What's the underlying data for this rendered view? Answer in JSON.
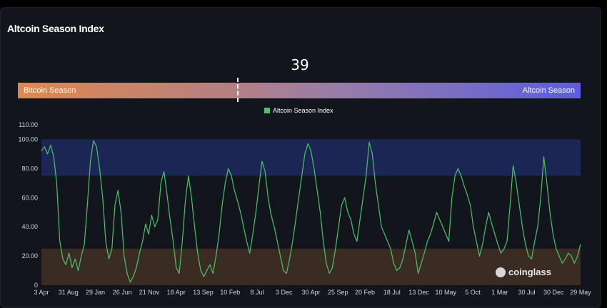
{
  "header": {
    "title": "Altcoin Season Index"
  },
  "gauge": {
    "value": "39",
    "value_num": 39,
    "left_label": "Bitcoin Season",
    "right_label": "Altcoin Season",
    "colors": {
      "start": "#e0884a",
      "end": "#5b5de0"
    }
  },
  "watermark": "coinglass",
  "chart_data": {
    "type": "line",
    "title": "",
    "legend": [
      "Altcoin Season Index"
    ],
    "legend_position": "top-center",
    "line_color": "#4cc26a",
    "ylim": [
      0,
      110
    ],
    "yticks": [
      "0",
      "20.00",
      "40.00",
      "60.00",
      "80.00",
      "100.00",
      "110.00"
    ],
    "ytick_values": [
      0,
      20,
      40,
      60,
      80,
      100,
      110
    ],
    "xticks": [
      "3 Apr",
      "31 Aug",
      "29 Jan",
      "26 Jun",
      "21 Nov",
      "18 Apr",
      "13 Sep",
      "10 Feb",
      "8 Jul",
      "3 Dec",
      "30 Apr",
      "25 Sep",
      "20 Feb",
      "18 Jul",
      "13 Dec",
      "10 May",
      "5 Oct",
      "1 Mar",
      "30 Jul",
      "30 Dec",
      "29 May"
    ],
    "bands": [
      {
        "name": "altcoin-season-zone",
        "from": 75,
        "to": 100,
        "color": "#1c2654"
      },
      {
        "name": "bitcoin-season-zone",
        "from": 0,
        "to": 25,
        "color": "#3a2c22"
      }
    ],
    "series": [
      {
        "name": "Altcoin Season Index",
        "values": [
          92,
          95,
          90,
          96,
          88,
          70,
          30,
          18,
          14,
          22,
          12,
          18,
          10,
          20,
          28,
          55,
          85,
          99,
          95,
          80,
          60,
          30,
          18,
          25,
          55,
          65,
          50,
          20,
          8,
          2,
          6,
          12,
          22,
          30,
          42,
          35,
          48,
          40,
          45,
          70,
          78,
          62,
          45,
          30,
          12,
          8,
          30,
          58,
          75,
          60,
          40,
          22,
          10,
          6,
          10,
          14,
          8,
          20,
          35,
          55,
          70,
          80,
          75,
          65,
          58,
          50,
          40,
          30,
          22,
          35,
          50,
          68,
          85,
          78,
          60,
          48,
          40,
          30,
          20,
          10,
          8,
          18,
          30,
          45,
          60,
          75,
          90,
          97,
          92,
          80,
          65,
          50,
          30,
          15,
          8,
          12,
          25,
          40,
          55,
          60,
          50,
          45,
          35,
          30,
          45,
          60,
          75,
          98,
          90,
          70,
          55,
          40,
          35,
          30,
          25,
          15,
          10,
          12,
          18,
          28,
          38,
          30,
          22,
          8,
          15,
          22,
          30,
          35,
          42,
          50,
          45,
          40,
          35,
          30,
          60,
          75,
          80,
          75,
          68,
          62,
          55,
          40,
          30,
          20,
          28,
          40,
          50,
          42,
          35,
          28,
          22,
          25,
          30,
          55,
          82,
          70,
          55,
          40,
          28,
          20,
          18,
          30,
          40,
          60,
          88,
          70,
          50,
          35,
          25,
          20,
          15,
          18,
          22,
          20,
          15,
          20,
          28
        ]
      }
    ]
  }
}
